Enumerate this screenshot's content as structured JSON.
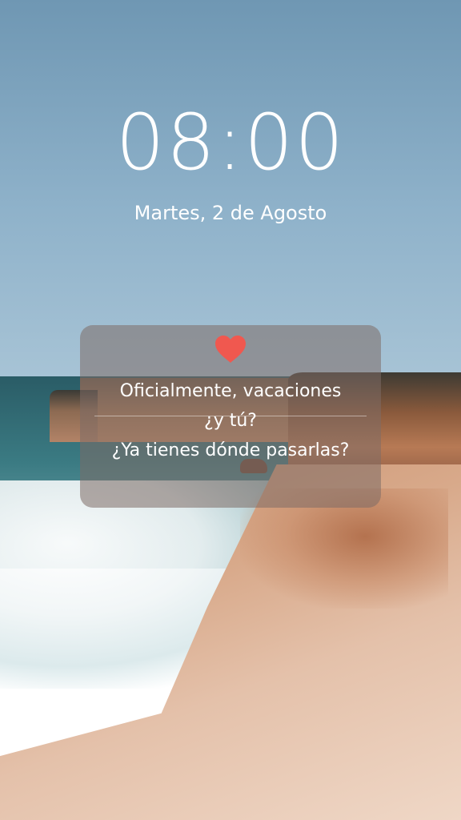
{
  "lockscreen": {
    "time": "08:00",
    "date": "Martes, 2 de Agosto"
  },
  "notification": {
    "icon": "heart-icon",
    "accent_color": "#f0584f",
    "line1": "Oficialmente, vacaciones",
    "line2": "¿y tú?",
    "line3": "¿Ya tienes dónde pasarlas?"
  }
}
